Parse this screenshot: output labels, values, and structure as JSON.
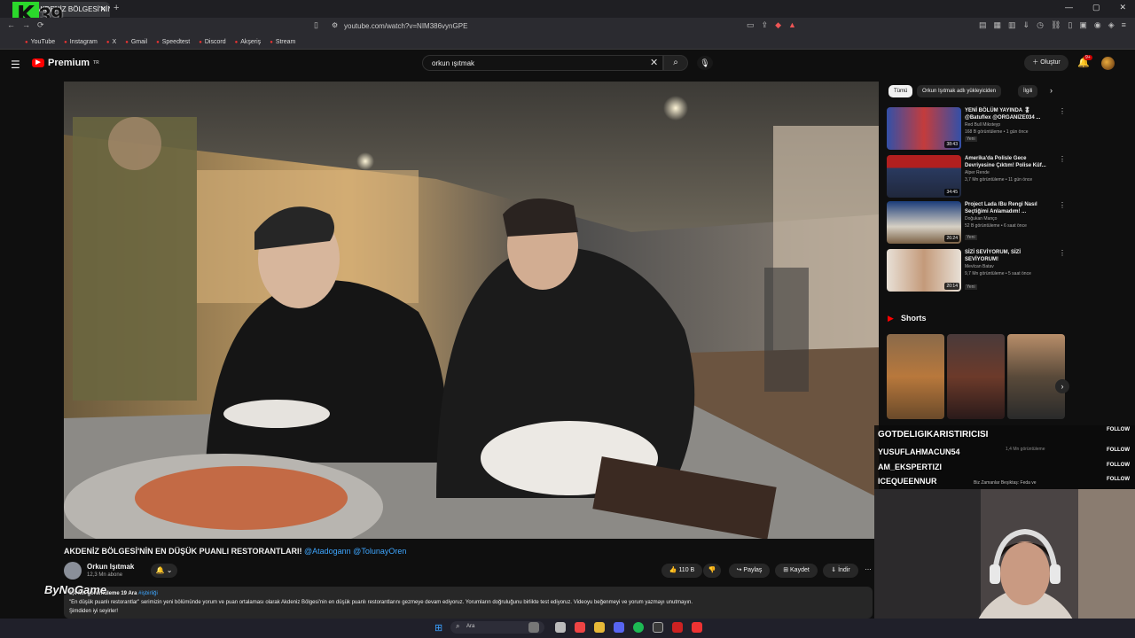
{
  "browser": {
    "tab_title": "AKDENİZ BÖLGESİ'NİN E",
    "url": "youtube.com/watch?v=NIM386vynGPE",
    "bookmarks": [
      "YouTube",
      "Instagram",
      "X",
      "Gmail",
      "Speedtest",
      "Discord",
      "Akşeriş",
      "Stream"
    ]
  },
  "overlay": {
    "logo_letter": "K",
    "counter": "39",
    "sponsor": "ByNoGame"
  },
  "youtube": {
    "logo_text": "Premium",
    "logo_sup": "TR",
    "search_value": "orkun ışıtmak",
    "create_label": "Oluştur",
    "notification_badge": "9+"
  },
  "video": {
    "title_main": "AKDENİZ BÖLGESİ'NİN EN DÜŞÜK PUANLI RESTORANTLARI!",
    "title_mentions": "@Atadogann @TolunayOren",
    "channel_name": "Orkun Işıtmak",
    "subscribers": "12,3 Mn abone",
    "like_count": "110 B",
    "share_label": "Paylaş",
    "save_label": "Kaydet",
    "download_label": "İndir",
    "desc_meta": "1,4 Mn görüntüleme  19 Ara",
    "desc_tag": "#işbirliği",
    "desc_text": "\"En düşük puanlı restorantlar\" serimizin yeni bölümünde yorum ve puan ortalaması olarak Akdeniz Bölgesi'nin en düşük puanlı restorantlarını gezmeye devam ediyoruz. Yorumların doğruluğunu birlikte test ediyoruz. Videoyu beğenmeyi ve yorum yazmayı unutmayın.",
    "desc_text2": "Şimdiden iyi seyirler!"
  },
  "sidebar": {
    "chips": [
      "Tümü",
      "Orkun Işıtmak adlı yükleyiciden",
      "İlgili"
    ],
    "recs": [
      {
        "title": "YENİ BÖLÜM YAYINDA 🎖 @Batuflex @ORGANIZE034 ...",
        "channel": "Red Bull Miksteyp",
        "views": "168 B görüntüleme • 1 gün önce",
        "duration": "38:43",
        "badge": "Yeni"
      },
      {
        "title": "Amerika'da Polisle Gece Devriyesine Çıktım! Polise Küf...",
        "channel": "Alper Rende",
        "views": "3,7 Mn görüntüleme • 11 gün önce",
        "duration": "34:45",
        "badge": ""
      },
      {
        "title": "Project Lada /Bu Rengi Nasıl Seçtiğimi Anlamadım! ...",
        "channel": "Doğukan Manço",
        "views": "52 B görüntüleme • 6 saat önce",
        "duration": "26:24",
        "badge": "Yeni"
      },
      {
        "title": "SİZİ SEVİYORUM, SİZİ SEVİYORUM!",
        "channel": "Mevlcan Batav",
        "views": "9,7 Mn görüntüleme • 5 saat önce",
        "duration": "20:14",
        "badge": "Yeni"
      }
    ],
    "shorts_title": "Shorts"
  },
  "chat": {
    "follows": [
      {
        "name": "GOTDELIGIKARISTIRICISI",
        "action": "FOLLOW"
      },
      {
        "name": "YUSUFLAHMACUN54",
        "action": "FOLLOW"
      },
      {
        "name": "AM_EKSPERTIZI",
        "action": "FOLLOW"
      },
      {
        "name": "ICEQUEENNUR",
        "action": "FOLLOW"
      }
    ],
    "ghost_views": "1,4 Mn görüntüleme",
    "ghost_title": "Biz Zamanlar Beşiktaş: Feda ve"
  },
  "taskbar": {
    "search_placeholder": "Ara"
  },
  "colors": {
    "yt_red": "#ff0000",
    "link_blue": "#3ea6ff",
    "overlay_green": "#2bd82b"
  }
}
